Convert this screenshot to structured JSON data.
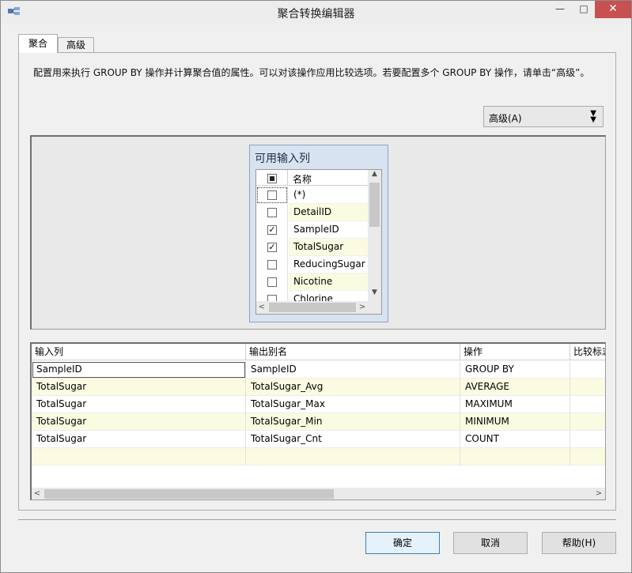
{
  "window": {
    "title": "聚合转换编辑器",
    "min_label": "—",
    "max_label": "□",
    "close_label": "✕"
  },
  "tabs": [
    {
      "label": "聚合",
      "active": true
    },
    {
      "label": "高级",
      "active": false
    }
  ],
  "description": "配置用来执行 GROUP BY 操作并计算聚合值的属性。可以对该操作应用比较选项。若要配置多个 GROUP BY 操作，请单击“高级”。",
  "advanced_button": {
    "label": "高级(A)",
    "chevron": "▼▼"
  },
  "available_columns": {
    "title": "可用输入列",
    "header_name": "名称",
    "rows": [
      {
        "name": "(*)",
        "checked": false
      },
      {
        "name": "DetailID",
        "checked": false
      },
      {
        "name": "SampleID",
        "checked": true
      },
      {
        "name": "TotalSugar",
        "checked": true
      },
      {
        "name": "ReducingSugar",
        "checked": false
      },
      {
        "name": "Nicotine",
        "checked": false
      },
      {
        "name": "Chlorine",
        "checked": false
      }
    ]
  },
  "grid": {
    "headers": [
      "输入列",
      "输出别名",
      "操作",
      "比较标志"
    ],
    "rows": [
      {
        "input": "SampleID",
        "alias": "SampleID",
        "operation": "GROUP BY",
        "flags": ""
      },
      {
        "input": "TotalSugar",
        "alias": "TotalSugar_Avg",
        "operation": "AVERAGE",
        "flags": ""
      },
      {
        "input": "TotalSugar",
        "alias": "TotalSugar_Max",
        "operation": "MAXIMUM",
        "flags": ""
      },
      {
        "input": "TotalSugar",
        "alias": "TotalSugar_Min",
        "operation": "MINIMUM",
        "flags": ""
      },
      {
        "input": "TotalSugar",
        "alias": "TotalSugar_Cnt",
        "operation": "COUNT",
        "flags": ""
      },
      {
        "input": "",
        "alias": "",
        "operation": "",
        "flags": ""
      }
    ]
  },
  "buttons": {
    "ok": "确定",
    "cancel": "取消",
    "help": "帮助(H)"
  },
  "colors": {
    "alt_row": "#fbfbe1",
    "close_button": "#c75050",
    "list_panel": "#d7e3f1"
  }
}
